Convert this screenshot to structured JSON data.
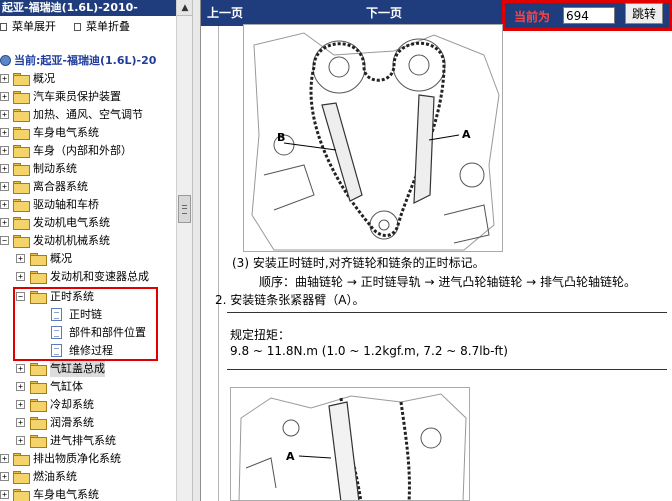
{
  "left_pane": {
    "title": "起亚-福瑞迪(1.6L)-2010-",
    "menu": {
      "expand": "菜单展开",
      "collapse": "菜单折叠"
    },
    "tree": {
      "root": "当前:起亚-福瑞迪(1.6L)-20",
      "top_items": [
        "概况",
        "汽车乘员保护装置",
        "加热、通风、空气调节",
        "车身电气系统",
        "车身（内部和外部）",
        "制动系统",
        "离合器系统",
        "驱动轴和车桥",
        "发动机电气系统",
        "发动机机械系统"
      ],
      "engine_mech_children": [
        "概况",
        "发动机和变速器总成",
        "正时系统"
      ],
      "timing_children": [
        "正时链",
        "部件和部件位置",
        "维修过程"
      ],
      "engine_mech_after": [
        "气缸盖总成",
        "气缸体",
        "冷却系统",
        "润滑系统",
        "进气排气系统"
      ],
      "bottom_items": [
        "排出物质净化系统",
        "燃油系统",
        "车身电气系统"
      ]
    }
  },
  "right_pane": {
    "nav": {
      "prev": "上一页",
      "next": "下一页",
      "current_label": "当前为",
      "current_value": "694",
      "go_button": "跳转"
    },
    "figure1": {
      "label_a": "A",
      "label_b": "B"
    },
    "figure2": {
      "label_a": "A"
    },
    "content": {
      "step3": "(3) 安装正时链时,对齐链轮和链条的正时标记。",
      "step3_sequence": "顺序：曲轴链轮 → 正时链导轨 → 进气凸轮轴链轮 → 排气凸轮轴链轮。",
      "step2": "2. 安装链条张紧器臂（A）。",
      "torque_label": "规定扭矩：",
      "torque_value": "9.8 ~ 11.8N.m (1.0 ~ 1.2kgf.m, 7.2 ~ 8.7lb-ft)"
    }
  },
  "colors": {
    "header_blue": "#1f3d7c",
    "highlight_red": "#e00000",
    "root_text_blue": "#1f3d9c"
  }
}
